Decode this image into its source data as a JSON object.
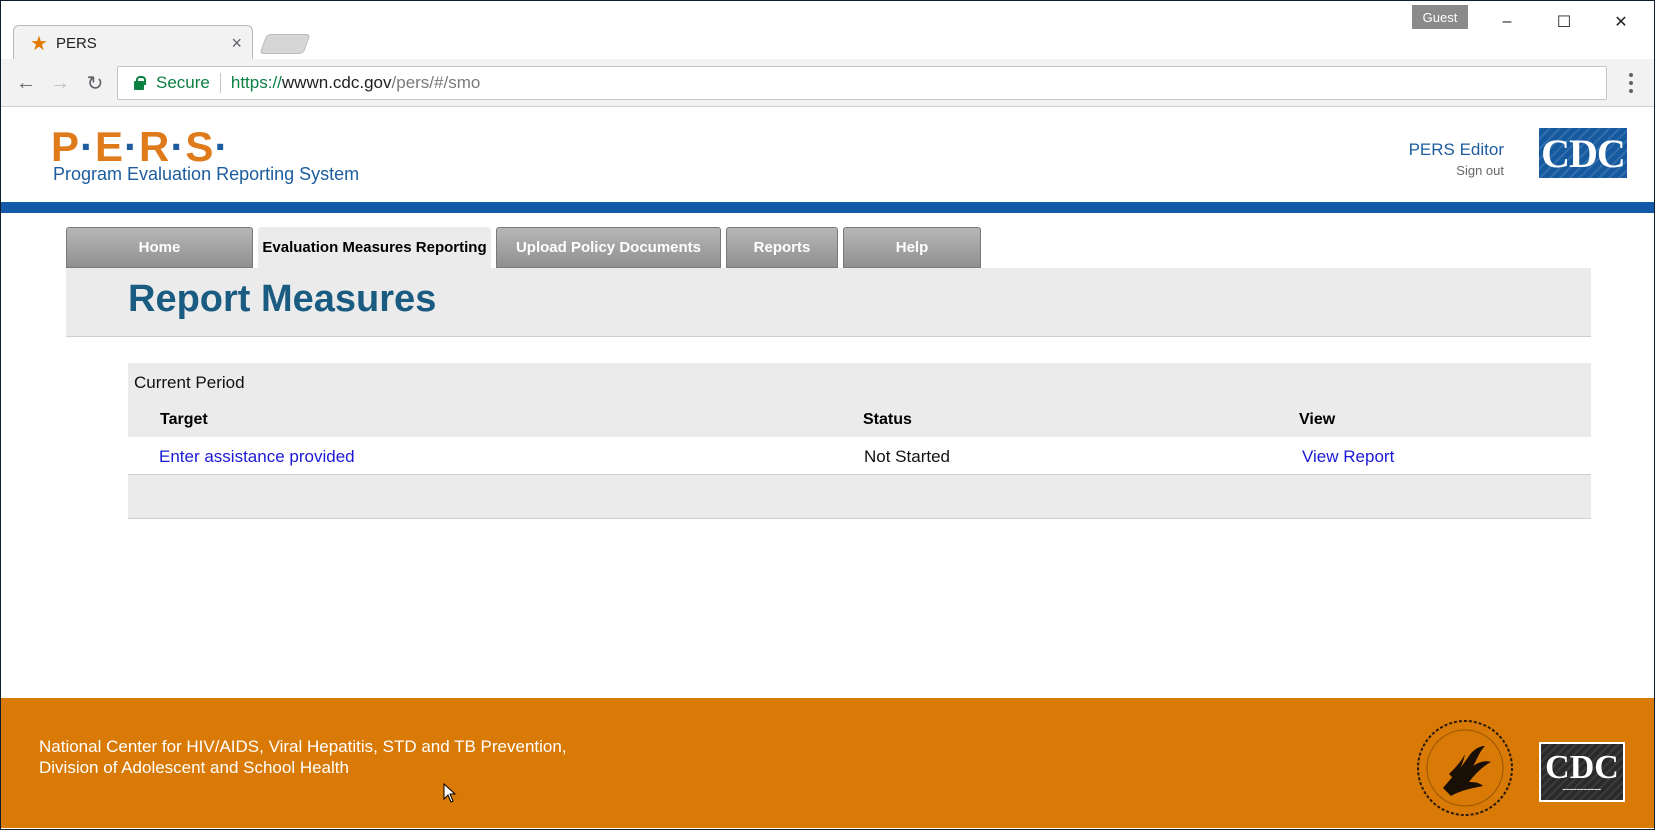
{
  "browser": {
    "tab_title": "PERS",
    "tab_close": "×",
    "profile": "Guest",
    "secure_label": "Secure",
    "url_scheme": "https://",
    "url_host": "wwwn.cdc.gov",
    "url_path": "/pers/#/smo",
    "window_controls": [
      "–",
      "☐",
      "✕"
    ]
  },
  "header": {
    "logo_letters": [
      "P",
      "E",
      "R",
      "S"
    ],
    "logo_subtitle": "Program Evaluation Reporting System",
    "user_name": "PERS Editor",
    "signout_label": "Sign out",
    "cdc_logo": "CDC"
  },
  "nav": {
    "tabs": [
      {
        "label": "Home",
        "active": false
      },
      {
        "label": "Evaluation Measures Reporting",
        "active": true
      },
      {
        "label": "Upload Policy Documents",
        "active": false
      },
      {
        "label": "Reports",
        "active": false
      },
      {
        "label": "Help",
        "active": false
      }
    ]
  },
  "main": {
    "title": "Report Measures",
    "period_label": "Current Period",
    "columns": [
      "Target",
      "Status",
      "View"
    ],
    "rows": [
      {
        "target": "Enter assistance provided",
        "status": "Not Started",
        "view": "View Report"
      }
    ]
  },
  "footer": {
    "line1": "National Center for HIV/AIDS, Viral Hepatitis, STD and TB Prevention,",
    "line2": "Division of Adolescent and School Health",
    "cdc_logo": "CDC"
  },
  "colors": {
    "brand_orange": "#d97a06",
    "brand_blue": "#1359a8",
    "title_blue": "#1a5b82",
    "link_blue": "#1a1ad6"
  }
}
